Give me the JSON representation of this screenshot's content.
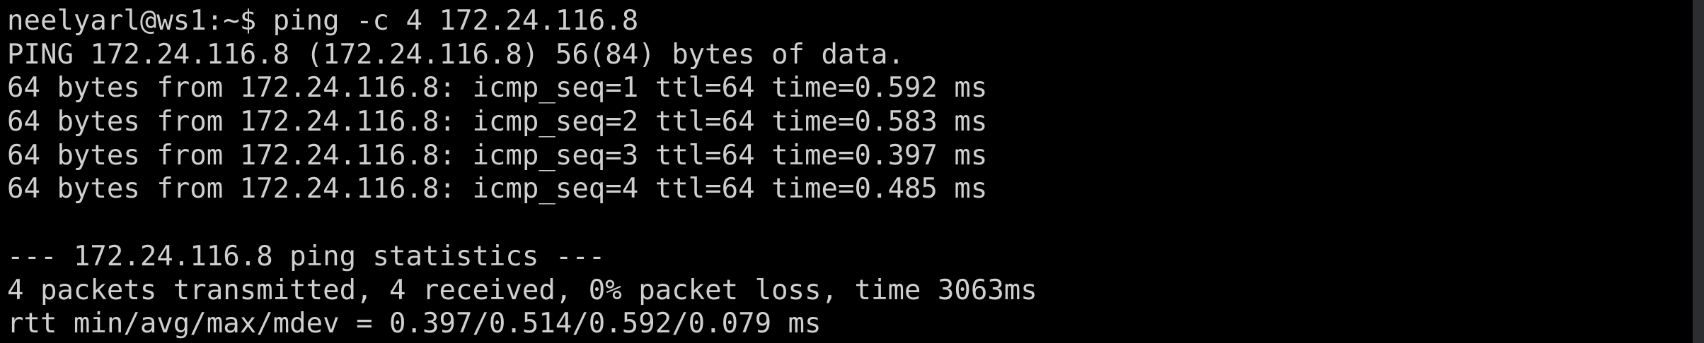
{
  "terminal": {
    "prompt_line": "neelyarl@ws1:~$ ping -c 4 172.24.116.8",
    "ping_header": "PING 172.24.116.8 (172.24.116.8) 56(84) bytes of data.",
    "replies": [
      "64 bytes from 172.24.116.8: icmp_seq=1 ttl=64 time=0.592 ms",
      "64 bytes from 172.24.116.8: icmp_seq=2 ttl=64 time=0.583 ms",
      "64 bytes from 172.24.116.8: icmp_seq=3 ttl=64 time=0.397 ms",
      "64 bytes from 172.24.116.8: icmp_seq=4 ttl=64 time=0.485 ms"
    ],
    "stats_header": "--- 172.24.116.8 ping statistics ---",
    "stats_packets": "4 packets transmitted, 4 received, 0% packet loss, time 3063ms",
    "stats_rtt": "rtt min/avg/max/mdev = 0.397/0.514/0.592/0.079 ms"
  },
  "colors": {
    "background": "#000000",
    "text": "#cfcfcf",
    "scrollbar": "#2b2d31"
  }
}
